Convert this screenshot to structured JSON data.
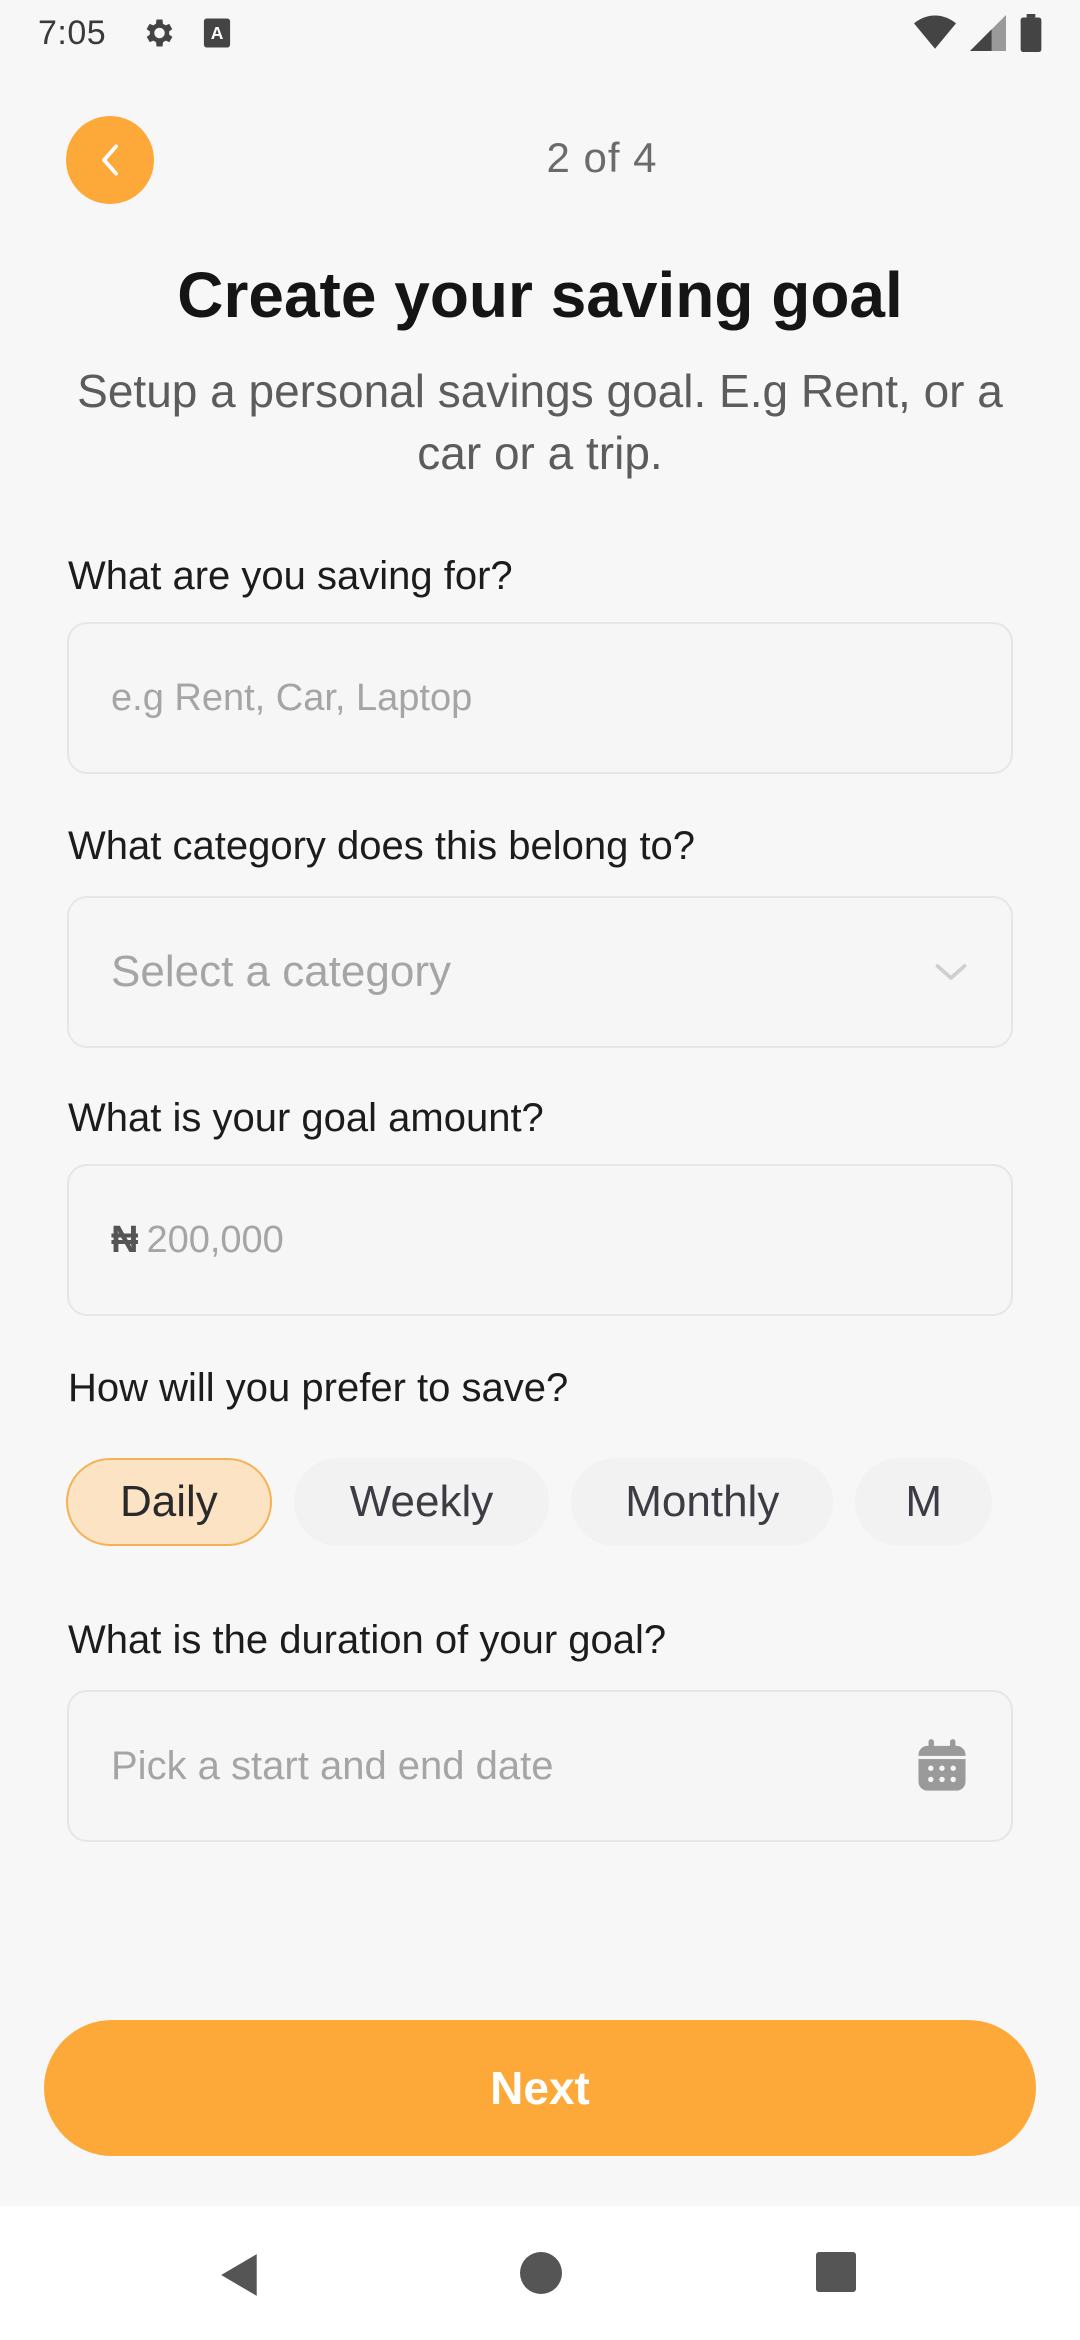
{
  "status_bar": {
    "time": "7:05",
    "icons": [
      "gear-icon",
      "keyboard-a-icon",
      "wifi-icon",
      "signal-icon",
      "battery-icon"
    ]
  },
  "header": {
    "back_icon": "chevron-left-icon",
    "step": "2 of 4",
    "title": "Create your saving goal",
    "subtitle": "Setup a personal savings goal. E.g Rent, or a car or a trip."
  },
  "form": {
    "saving_for": {
      "label": "What are you saving for?",
      "placeholder": "e.g Rent, Car, Laptop",
      "value": ""
    },
    "category": {
      "label": "What category does this belong to?",
      "placeholder": "Select a category",
      "icon": "chevron-down-icon"
    },
    "amount": {
      "label": "What is your goal amount?",
      "currency": "₦",
      "placeholder": "200,000"
    },
    "frequency": {
      "label": "How will you prefer to save?",
      "options": [
        "Daily",
        "Weekly",
        "Monthly",
        "M"
      ],
      "selected": "Daily"
    },
    "duration": {
      "label": "What is the duration of your goal?",
      "placeholder": "Pick a start and end date",
      "icon": "calendar-icon"
    }
  },
  "actions": {
    "next_label": "Next"
  },
  "nav_bar": {
    "icons": [
      "back-triangle-icon",
      "home-circle-icon",
      "recents-square-icon"
    ]
  },
  "colors": {
    "accent": "#fca93a",
    "chip_active_bg": "#fbe3c4",
    "background": "#f7f7f7"
  }
}
